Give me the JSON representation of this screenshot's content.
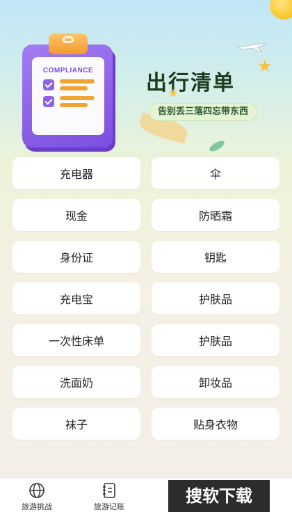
{
  "header": {
    "clipboard_label": "COMPLIANCE",
    "title": "出行清单",
    "subtitle": "告别丢三落四忘带东西"
  },
  "checklist": [
    {
      "label": "充电器"
    },
    {
      "label": "伞"
    },
    {
      "label": "现金"
    },
    {
      "label": "防晒霜"
    },
    {
      "label": "身份证"
    },
    {
      "label": "钥匙"
    },
    {
      "label": "充电宝"
    },
    {
      "label": "护肤品"
    },
    {
      "label": "一次性床单"
    },
    {
      "label": "护肤品"
    },
    {
      "label": "洗面奶"
    },
    {
      "label": "卸妆品"
    },
    {
      "label": "袜子"
    },
    {
      "label": "贴身衣物"
    }
  ],
  "tabbar": {
    "tabs": [
      {
        "label": "旅游挑战",
        "icon": "globe-icon"
      },
      {
        "label": "旅游记账",
        "icon": "notebook-icon"
      }
    ]
  },
  "watermark": "搜软下载",
  "colors": {
    "accent_purple": "#7b4fe0",
    "accent_orange": "#f39a2e",
    "title_color": "#1f3a1f"
  }
}
